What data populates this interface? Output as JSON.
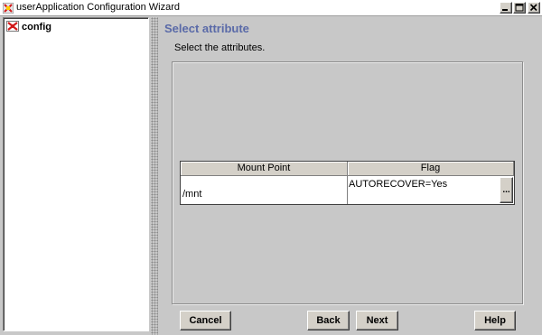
{
  "window": {
    "title": "userApplication Configuration Wizard",
    "icons": [
      "app-icon",
      "minimize-icon",
      "maximize-icon",
      "close-icon"
    ]
  },
  "tree": {
    "items": [
      {
        "label": "config",
        "icon": "config-icon"
      }
    ]
  },
  "main": {
    "heading": "Select attribute",
    "instruction": "Select the attributes.",
    "heading_color": "#5a6aa8"
  },
  "table": {
    "columns": [
      "Mount Point",
      "Flag"
    ],
    "rows": [
      {
        "mount_point": "/mnt",
        "flag": "AUTORECOVER=Yes",
        "edit_label": "..."
      }
    ]
  },
  "buttons": {
    "cancel": "Cancel",
    "back": "Back",
    "next": "Next",
    "help": "Help"
  }
}
